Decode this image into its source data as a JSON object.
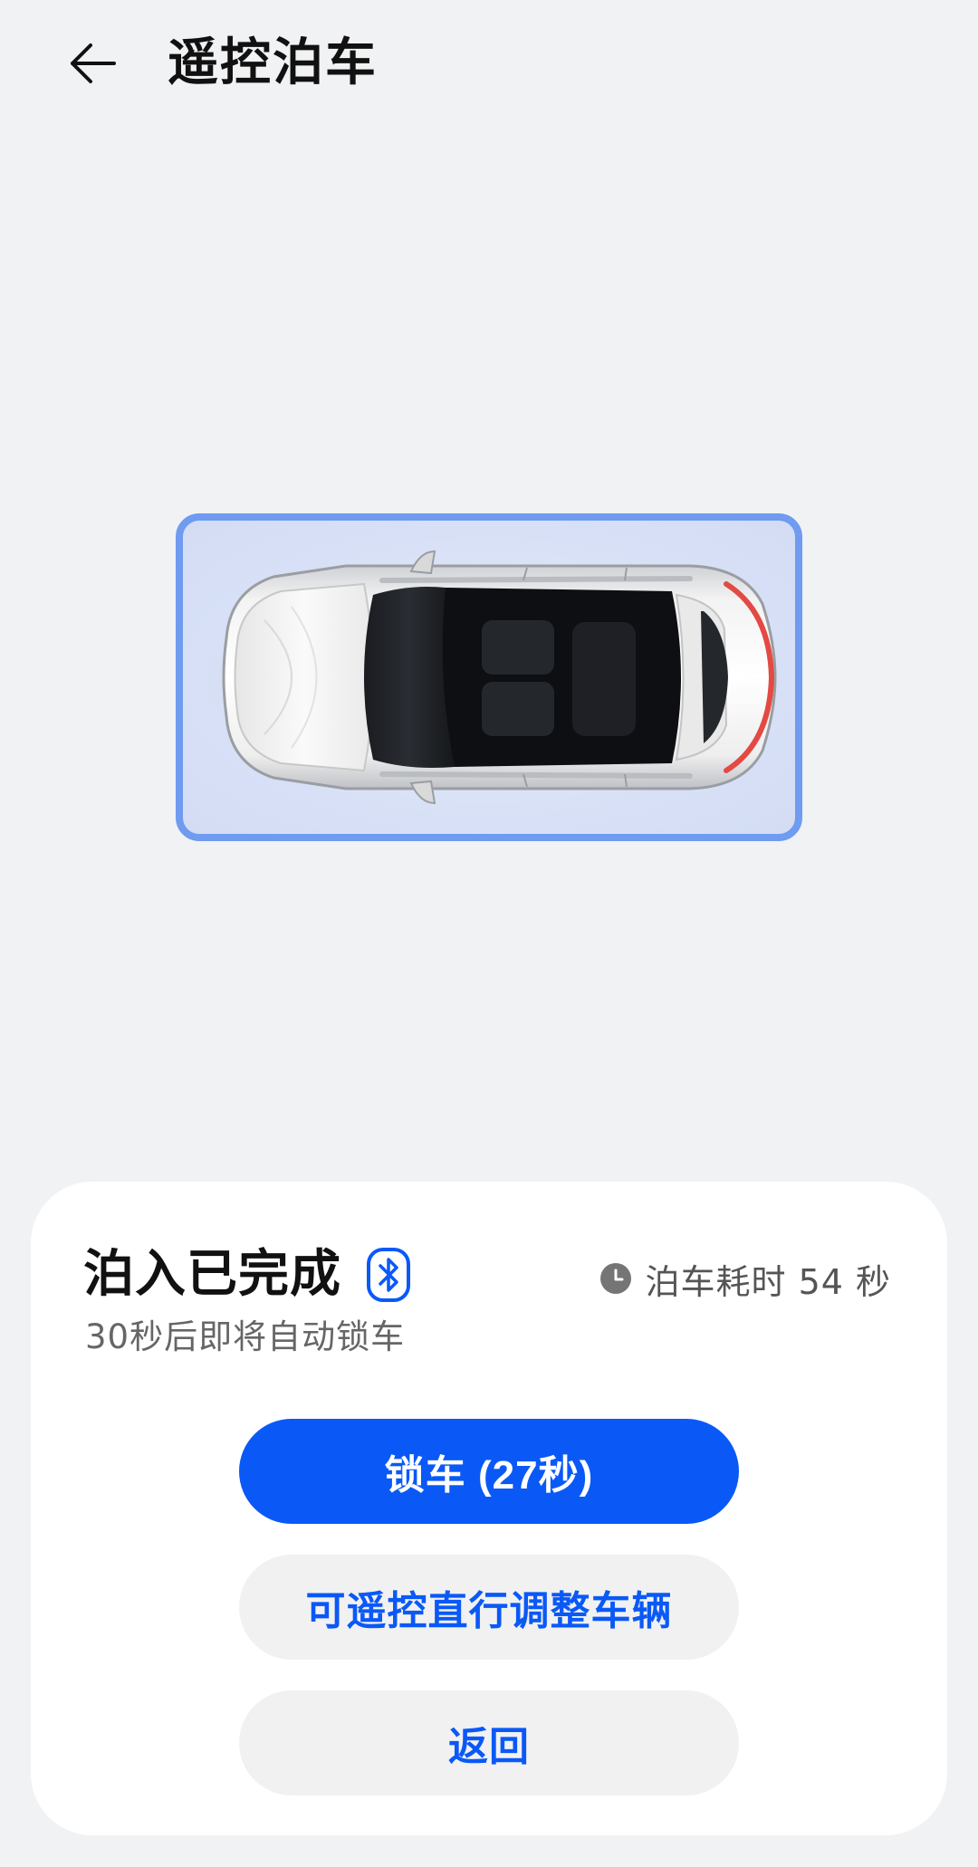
{
  "header": {
    "title": "遥控泊车",
    "back_icon": "arrow-left-icon"
  },
  "status_card": {
    "title": "泊入已完成",
    "connection_icon": "bluetooth-icon",
    "subtitle": "30秒后即将自动锁车",
    "elapsed_icon": "clock-icon",
    "elapsed_label": "泊车耗时 54 秒"
  },
  "actions": {
    "lock_label": "锁车 (27秒)",
    "adjust_label": "可遥控直行调整车辆",
    "back_label": "返回"
  },
  "colors": {
    "accent": "#0a59f7",
    "slot_border": "#6f9bf0",
    "background": "#f1f2f4"
  }
}
